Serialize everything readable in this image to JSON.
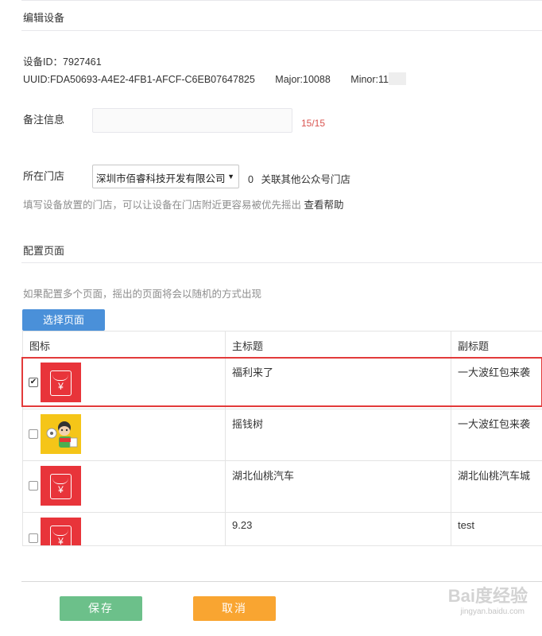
{
  "edit_section": {
    "title": "编辑设备"
  },
  "device": {
    "id_label": "设备ID：",
    "id_value": "7927461",
    "uuid_label": "UUID: ",
    "uuid_value": "FDA50693-A4E2-4FB1-AFCF-C6EB07647825",
    "major_label": "Major: ",
    "major_value": "10088",
    "minor_label": "Minor: ",
    "minor_value": "11"
  },
  "remark": {
    "label": "备注信息",
    "value": "",
    "counter": "15/15"
  },
  "store": {
    "label": "所在门店",
    "selected": "深圳市佰睿科技开发有限公司",
    "related_count": "0",
    "related_text": "关联其他公众号门店",
    "hint": "填写设备放置的门店，可以让设备在门店附近更容易被优先摇出",
    "help_link": "查看帮助"
  },
  "config_section": {
    "title": "配置页面",
    "hint": "如果配置多个页面，摇出的页面将会以随机的方式出现",
    "choose_button": "选择页面"
  },
  "table": {
    "headers": [
      "图标",
      "主标题",
      "副标题"
    ],
    "rows": [
      {
        "checked": true,
        "icon": "red-envelope-icon",
        "title": "福利来了",
        "subtitle": "一大波红包来袭"
      },
      {
        "checked": false,
        "icon": "money-tree-icon",
        "title": "摇钱树",
        "subtitle": "一大波红包来袭"
      },
      {
        "checked": false,
        "icon": "red-envelope-icon",
        "title": "湖北仙桃汽车",
        "subtitle": "湖北仙桃汽车城"
      },
      {
        "checked": false,
        "icon": "red-envelope-icon",
        "title": "9.23",
        "subtitle": "test"
      }
    ],
    "yen_symbol": "¥",
    "check_mark": "✔"
  },
  "actions": {
    "save": "保存",
    "cancel": "取消"
  },
  "watermark": {
    "text": "Bai度经验",
    "url": "jingyan.baidu.com"
  },
  "colors": {
    "primary": "#4a90d9",
    "save": "#6cc08a",
    "cancel": "#f9a531",
    "highlight": "#e23a3a",
    "red_envelope": "#e8343a"
  }
}
